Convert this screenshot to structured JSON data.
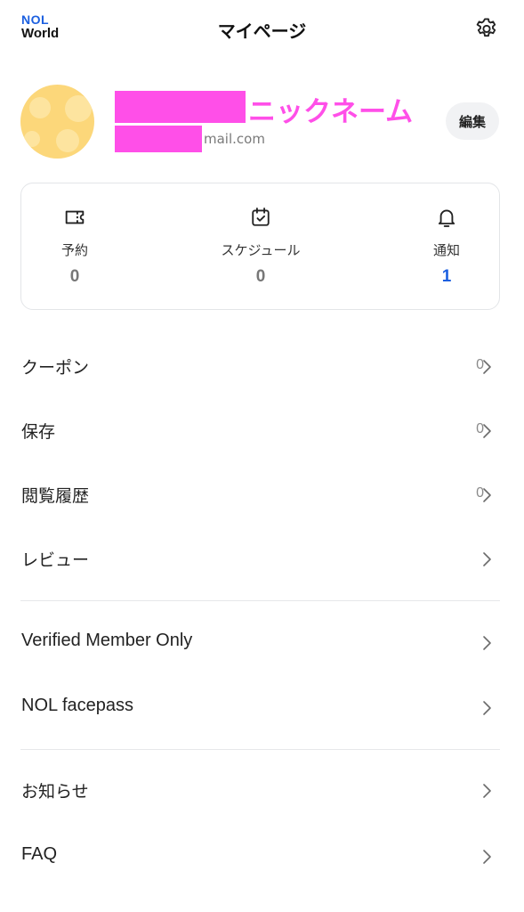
{
  "header": {
    "logo_line1": "NOL",
    "logo_line2": "World",
    "title": "マイページ"
  },
  "profile": {
    "nickname": "ニックネーム",
    "email_suffix": "mail.com",
    "edit_label": "編集",
    "avatar_color": "#fcd77a",
    "redaction_color": "#ff4fe8"
  },
  "stats": [
    {
      "icon": "ticket-icon",
      "label": "予約",
      "value": "0"
    },
    {
      "icon": "calendar-check-icon",
      "label": "スケジュール",
      "value": "0"
    },
    {
      "icon": "bell-icon",
      "label": "通知",
      "value": "1"
    }
  ],
  "menu": {
    "coupon": {
      "label": "クーポン",
      "count": "0"
    },
    "saved": {
      "label": "保存",
      "count": "0"
    },
    "history": {
      "label": "閲覧履歴",
      "count": "0"
    },
    "review": {
      "label": "レビュー"
    },
    "verified": {
      "label": "Verified Member Only"
    },
    "facepass": {
      "label": "NOL facepass"
    },
    "notice": {
      "label": "お知らせ"
    },
    "faq": {
      "label": "FAQ"
    }
  },
  "colors": {
    "accent": "#1b5fe0",
    "divider": "#e6e7ea"
  }
}
